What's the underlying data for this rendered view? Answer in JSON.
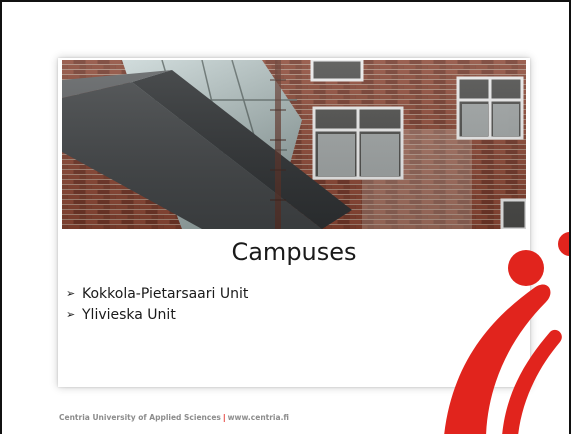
{
  "slide": {
    "title": "Campuses",
    "bullets": [
      {
        "label": "Kokkola-Pietarsaari Unit"
      },
      {
        "label": "Ylivieska Unit"
      }
    ],
    "bullet_glyph": "➢"
  },
  "footer": {
    "org": "Centria University of Applied Sciences",
    "separator": "|",
    "website": "www.centria.fi"
  },
  "colors": {
    "brand_red": "#e1241d",
    "brick": "#7a3d2c",
    "text": "#1a1a1a",
    "footer_text": "#8c8c8c"
  },
  "icons": {
    "bullet": "arrowhead-bullet-icon",
    "logo": "centria-swoosh-logo"
  }
}
